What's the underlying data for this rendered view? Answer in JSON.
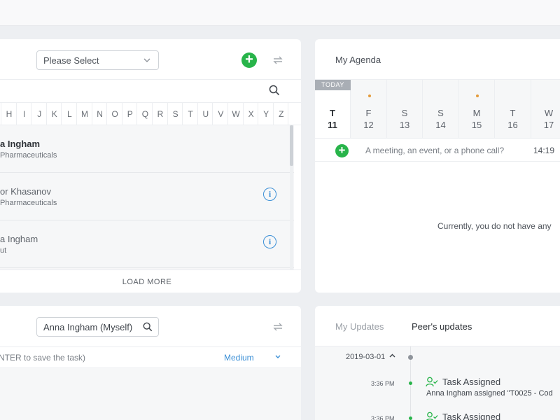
{
  "contacts": {
    "select_placeholder": "Please Select",
    "alphabet": [
      "H",
      "I",
      "J",
      "K",
      "L",
      "M",
      "N",
      "O",
      "P",
      "Q",
      "R",
      "S",
      "T",
      "U",
      "V",
      "W",
      "X",
      "Y",
      "Z"
    ],
    "rows": [
      {
        "name": "a Ingham",
        "org": "Pharmaceuticals",
        "bold": true,
        "info": false
      },
      {
        "name": "or Khasanov",
        "org": "Pharmaceuticals",
        "bold": false,
        "info": true
      },
      {
        "name": "a Ingham",
        "org": "ut",
        "bold": false,
        "info": true
      }
    ],
    "load_more": "LOAD MORE"
  },
  "agenda": {
    "title": "My Agenda",
    "today_label": "TODAY",
    "days": [
      {
        "dow": "T",
        "num": "11",
        "today": true,
        "dot": false
      },
      {
        "dow": "F",
        "num": "12",
        "today": false,
        "dot": true
      },
      {
        "dow": "S",
        "num": "13",
        "today": false,
        "dot": false
      },
      {
        "dow": "S",
        "num": "14",
        "today": false,
        "dot": false
      },
      {
        "dow": "M",
        "num": "15",
        "today": false,
        "dot": true
      },
      {
        "dow": "T",
        "num": "16",
        "today": false,
        "dot": false
      },
      {
        "dow": "W",
        "num": "17",
        "today": false,
        "dot": false
      }
    ],
    "input_placeholder": "A meeting, an event, or a phone call?",
    "input_time": "14:19",
    "empty_message": "Currently, you do not have any"
  },
  "tasks": {
    "assignee": "Anna Ingham (Myself)",
    "input_hint": "ENTER to save the task)",
    "priority": "Medium"
  },
  "updates": {
    "tab_mine": "My Updates",
    "tab_peers": "Peer's updates",
    "date": "2019-03-01",
    "events": [
      {
        "time": "3:36 PM",
        "title": "Task Assigned",
        "desc": "Anna Ingham assigned \"T0025 - Cod"
      },
      {
        "time": "3:36 PM",
        "title": "Task Assigned",
        "desc": ""
      }
    ]
  },
  "colors": {
    "accent_green": "#28b44a",
    "link_blue": "#3b8fd6",
    "dot_orange": "#e49b3c"
  }
}
